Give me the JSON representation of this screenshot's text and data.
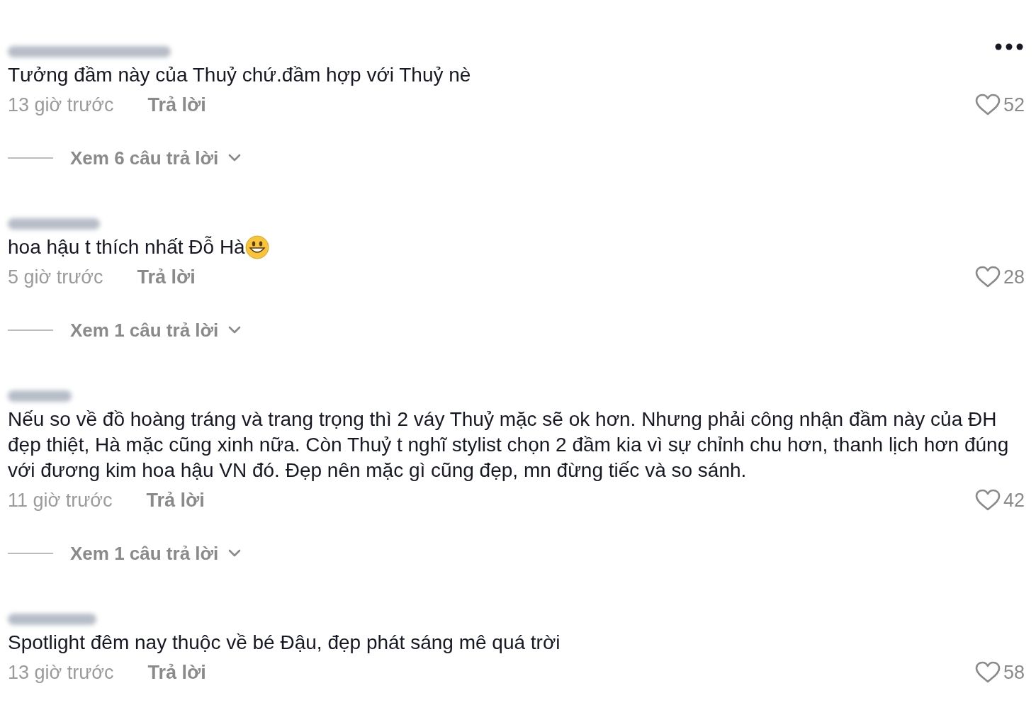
{
  "comments": [
    {
      "text": "Tưởng đầm này của Thuỷ chứ.đầm hợp với Thuỷ nè",
      "emoji": false,
      "time": "13 giờ trước",
      "reply": "Trả lời",
      "likes": "52",
      "liked": false,
      "view_replies": "Xem 6 câu trả lời"
    },
    {
      "text": "hoa hậu t thích nhất Đỗ Hà",
      "emoji": true,
      "time": "5 giờ trước",
      "reply": "Trả lời",
      "likes": "28",
      "liked": false,
      "view_replies": "Xem 1 câu trả lời"
    },
    {
      "text": "Nếu so về đồ hoàng tráng và trang trọng thì 2 váy Thuỷ mặc sẽ ok hơn. Nhưng phải công nhận đầm này của ĐH đẹp thiệt, Hà mặc cũng xinh nữa. Còn Thuỷ t nghĩ stylist chọn 2 đầm kia vì sự chỉnh chu hơn, thanh lịch hơn đúng với đương kim hoa hậu VN đó. Đẹp nên mặc gì cũng đẹp, mn đừng tiếc và so sánh.",
      "emoji": false,
      "time": "11 giờ trước",
      "reply": "Trả lời",
      "likes": "42",
      "liked": false,
      "view_replies": "Xem 1 câu trả lời"
    },
    {
      "text": "Spotlight đêm nay thuộc về bé Đậu, đẹp phát sáng mê quá trời",
      "emoji": false,
      "time": "13 giờ trước",
      "reply": "Trả lời",
      "likes": "58",
      "liked": false
    }
  ]
}
